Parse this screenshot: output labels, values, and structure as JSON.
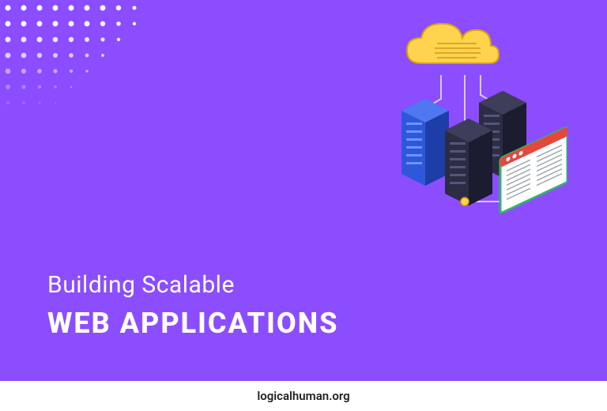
{
  "heading": {
    "line1": "Building Scalable",
    "line2": "WEB APPLICATIONS"
  },
  "footer": {
    "site": "logicalhuman.org"
  },
  "colors": {
    "bg": "#8b4dff",
    "text": "#ffffff",
    "footer_bg": "#ffffff",
    "footer_text": "#222222"
  },
  "illustration": {
    "name": "cloud-servers-browser-isometric-icon",
    "elements": [
      "cloud",
      "server-blue",
      "server-dark-1",
      "server-dark-2",
      "browser-window",
      "connection-lines"
    ]
  }
}
